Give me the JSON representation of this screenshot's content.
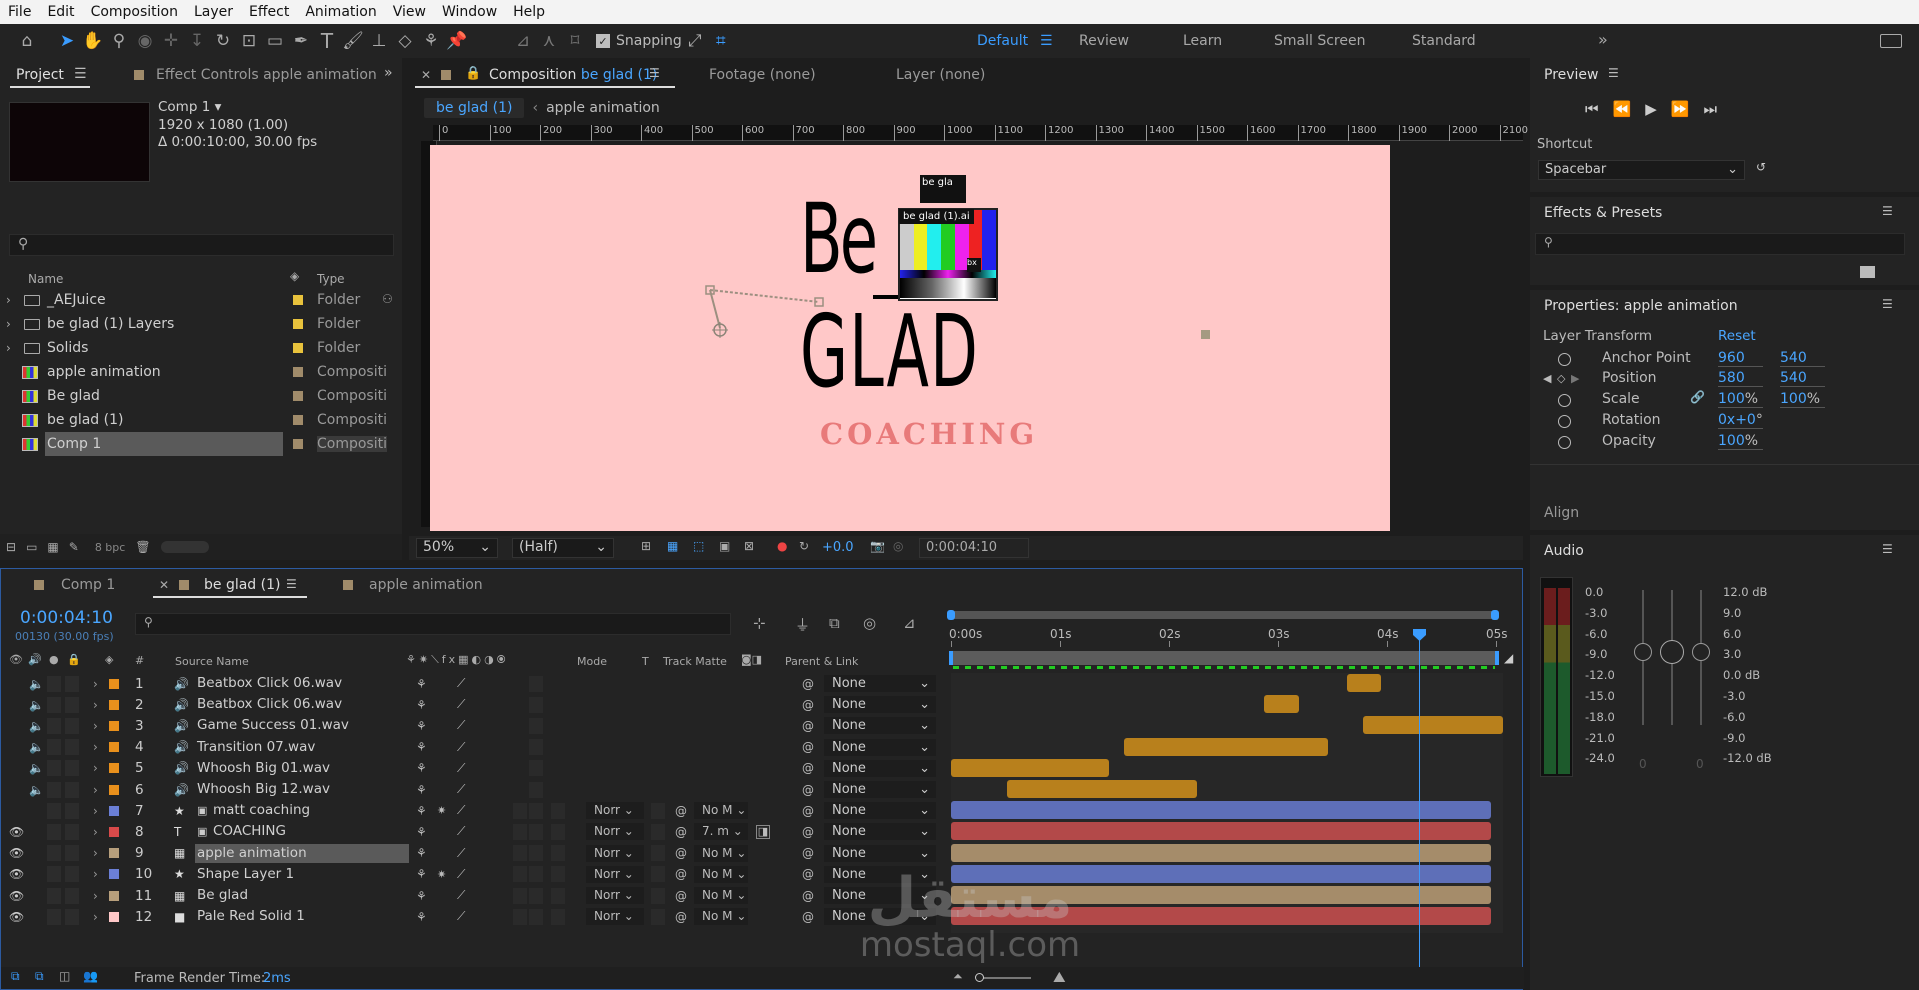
{
  "menu": [
    "File",
    "Edit",
    "Composition",
    "Layer",
    "Effect",
    "Animation",
    "View",
    "Window",
    "Help"
  ],
  "toolbar": {
    "snapping_label": "Snapping",
    "workspaces": [
      "Default",
      "Review",
      "Learn",
      "Small Screen",
      "Standard"
    ],
    "active_workspace": "Default",
    "overflow": "»"
  },
  "project": {
    "tab_project": "Project",
    "tab_effect_controls": "Effect Controls apple animation",
    "comp_name": "Comp 1",
    "comp_size": "1920 x 1080 (1.00)",
    "comp_duration": "Δ 0:00:10:00, 30.00 fps",
    "col_name": "Name",
    "col_type": "Type",
    "items": [
      {
        "name": "_AEJuice",
        "type": "Folder",
        "kind": "folder",
        "color": "#e8c23c"
      },
      {
        "name": "be glad (1) Layers",
        "type": "Folder",
        "kind": "folder",
        "color": "#e8c23c"
      },
      {
        "name": "Solids",
        "type": "Folder",
        "kind": "folder",
        "color": "#e8c23c"
      },
      {
        "name": "apple animation",
        "type": "Compositi",
        "kind": "comp",
        "color": "#a08b6a"
      },
      {
        "name": "Be glad",
        "type": "Compositi",
        "kind": "comp",
        "color": "#a08b6a"
      },
      {
        "name": "be glad (1)",
        "type": "Compositi",
        "kind": "comp",
        "color": "#a08b6a"
      },
      {
        "name": "Comp 1",
        "type": "Compositi",
        "kind": "comp",
        "color": "#a08b6a",
        "selected": true
      }
    ],
    "bpc": "8 bpc"
  },
  "composition": {
    "tab_label_prefix": "Composition",
    "tab_label_name": "be glad (1)",
    "footage_tab": "Footage  (none)",
    "layer_tab": "Layer  (none)",
    "breadcrumb": [
      "be glad (1)",
      "apple animation"
    ],
    "ruler": [
      "0",
      "100",
      "200",
      "300",
      "400",
      "500",
      "600",
      "700",
      "800",
      "900",
      "1000",
      "1100",
      "1200",
      "1300",
      "1400",
      "1500",
      "1600",
      "1700",
      "1800",
      "1900",
      "2000",
      "2100"
    ],
    "canvas_bg": "#ffc8c8",
    "art_be": "Be",
    "art_glad": "GLAD",
    "art_coaching": "COACHING",
    "overlay_label1": "be gla",
    "overlay_label2": "be glad (1).ai",
    "zoom": "50%",
    "resolution": "(Half)",
    "exposure": "+0.0",
    "timecode": "0:00:04:10"
  },
  "timeline": {
    "tabs": [
      "Comp 1",
      "be glad (1)",
      "apple animation"
    ],
    "active_tab": "be glad (1)",
    "timecode": "0:00:04:10",
    "frames": "00130 (30.00 fps)",
    "col_source": "Source Name",
    "col_mode": "Mode",
    "col_t": "T",
    "col_track": "Track Matte",
    "col_parent": "Parent & Link",
    "time_ticks": [
      "0:00s",
      "01s",
      "02s",
      "03s",
      "04s",
      "05s"
    ],
    "layers": [
      {
        "num": "1",
        "name": "Beatbox Click 06.wav",
        "color": "#e8901c",
        "kind": "audio",
        "parent": "None"
      },
      {
        "num": "2",
        "name": "Beatbox Click 06.wav",
        "color": "#e8901c",
        "kind": "audio",
        "parent": "None"
      },
      {
        "num": "3",
        "name": "Game Success 01.wav",
        "color": "#e8901c",
        "kind": "audio",
        "parent": "None"
      },
      {
        "num": "4",
        "name": "Transition 07.wav",
        "color": "#e8901c",
        "kind": "audio",
        "parent": "None"
      },
      {
        "num": "5",
        "name": "Whoosh Big 01.wav",
        "color": "#e8901c",
        "kind": "audio",
        "parent": "None"
      },
      {
        "num": "6",
        "name": "Whoosh Big 12.wav",
        "color": "#e8901c",
        "kind": "audio",
        "parent": "None"
      },
      {
        "num": "7",
        "name": "matt coaching",
        "color": "#6b7fd6",
        "kind": "shape",
        "mode": "Norr",
        "track": "No M",
        "parent": "None"
      },
      {
        "num": "8",
        "name": "COACHING",
        "color": "#d94a4a",
        "kind": "text",
        "mode": "Norr",
        "track": "7. m",
        "parent": "None"
      },
      {
        "num": "9",
        "name": "apple animation",
        "color": "#b79f7c",
        "kind": "comp",
        "mode": "Norr",
        "track": "No M",
        "parent": "None",
        "selected": true
      },
      {
        "num": "10",
        "name": "Shape Layer 1",
        "color": "#6b7fd6",
        "kind": "shape",
        "mode": "Norr",
        "track": "No M",
        "parent": "None"
      },
      {
        "num": "11",
        "name": "Be glad",
        "color": "#b79f7c",
        "kind": "comp",
        "mode": "Norr",
        "track": "No M",
        "parent": "None"
      },
      {
        "num": "12",
        "name": "Pale Red Solid 1",
        "color": "#ffc8c8",
        "kind": "solid",
        "mode": "Norr",
        "track": "No M",
        "parent": "None"
      }
    ],
    "render_time_label": "Frame Render Time:",
    "render_time": "2ms"
  },
  "preview": {
    "title": "Preview",
    "shortcut_label": "Shortcut",
    "shortcut_value": "Spacebar"
  },
  "effects_presets": {
    "title": "Effects & Presets"
  },
  "properties": {
    "title": "Properties: apple animation",
    "section": "Layer Transform",
    "reset": "Reset",
    "anchor_label": "Anchor Point",
    "anchor_x": "960",
    "anchor_y": "540",
    "position_label": "Position",
    "position_x": "580",
    "position_y": "540",
    "scale_label": "Scale",
    "scale_x": "100",
    "scale_y": "100",
    "scale_unit": "%",
    "rotation_label": "Rotation",
    "rotation_value": "0x+0",
    "rotation_unit": "°",
    "opacity_label": "Opacity",
    "opacity_value": "100",
    "opacity_unit": "%"
  },
  "align": {
    "title": "Align"
  },
  "audio": {
    "title": "Audio",
    "left_scale": [
      "0.0",
      "-3.0",
      "-6.0",
      "-9.0",
      "-12.0",
      "-15.0",
      "-18.0",
      "-21.0",
      "-24.0"
    ],
    "right_scale": [
      "12.0 dB",
      "9.0",
      "6.0",
      "3.0",
      "0.0 dB",
      "-3.0",
      "-6.0",
      "-9.0",
      "-12.0 dB"
    ],
    "knob_values": [
      "0",
      "0"
    ]
  },
  "watermark": {
    "arabic": "مستقل",
    "latin": "mostaql.com"
  }
}
